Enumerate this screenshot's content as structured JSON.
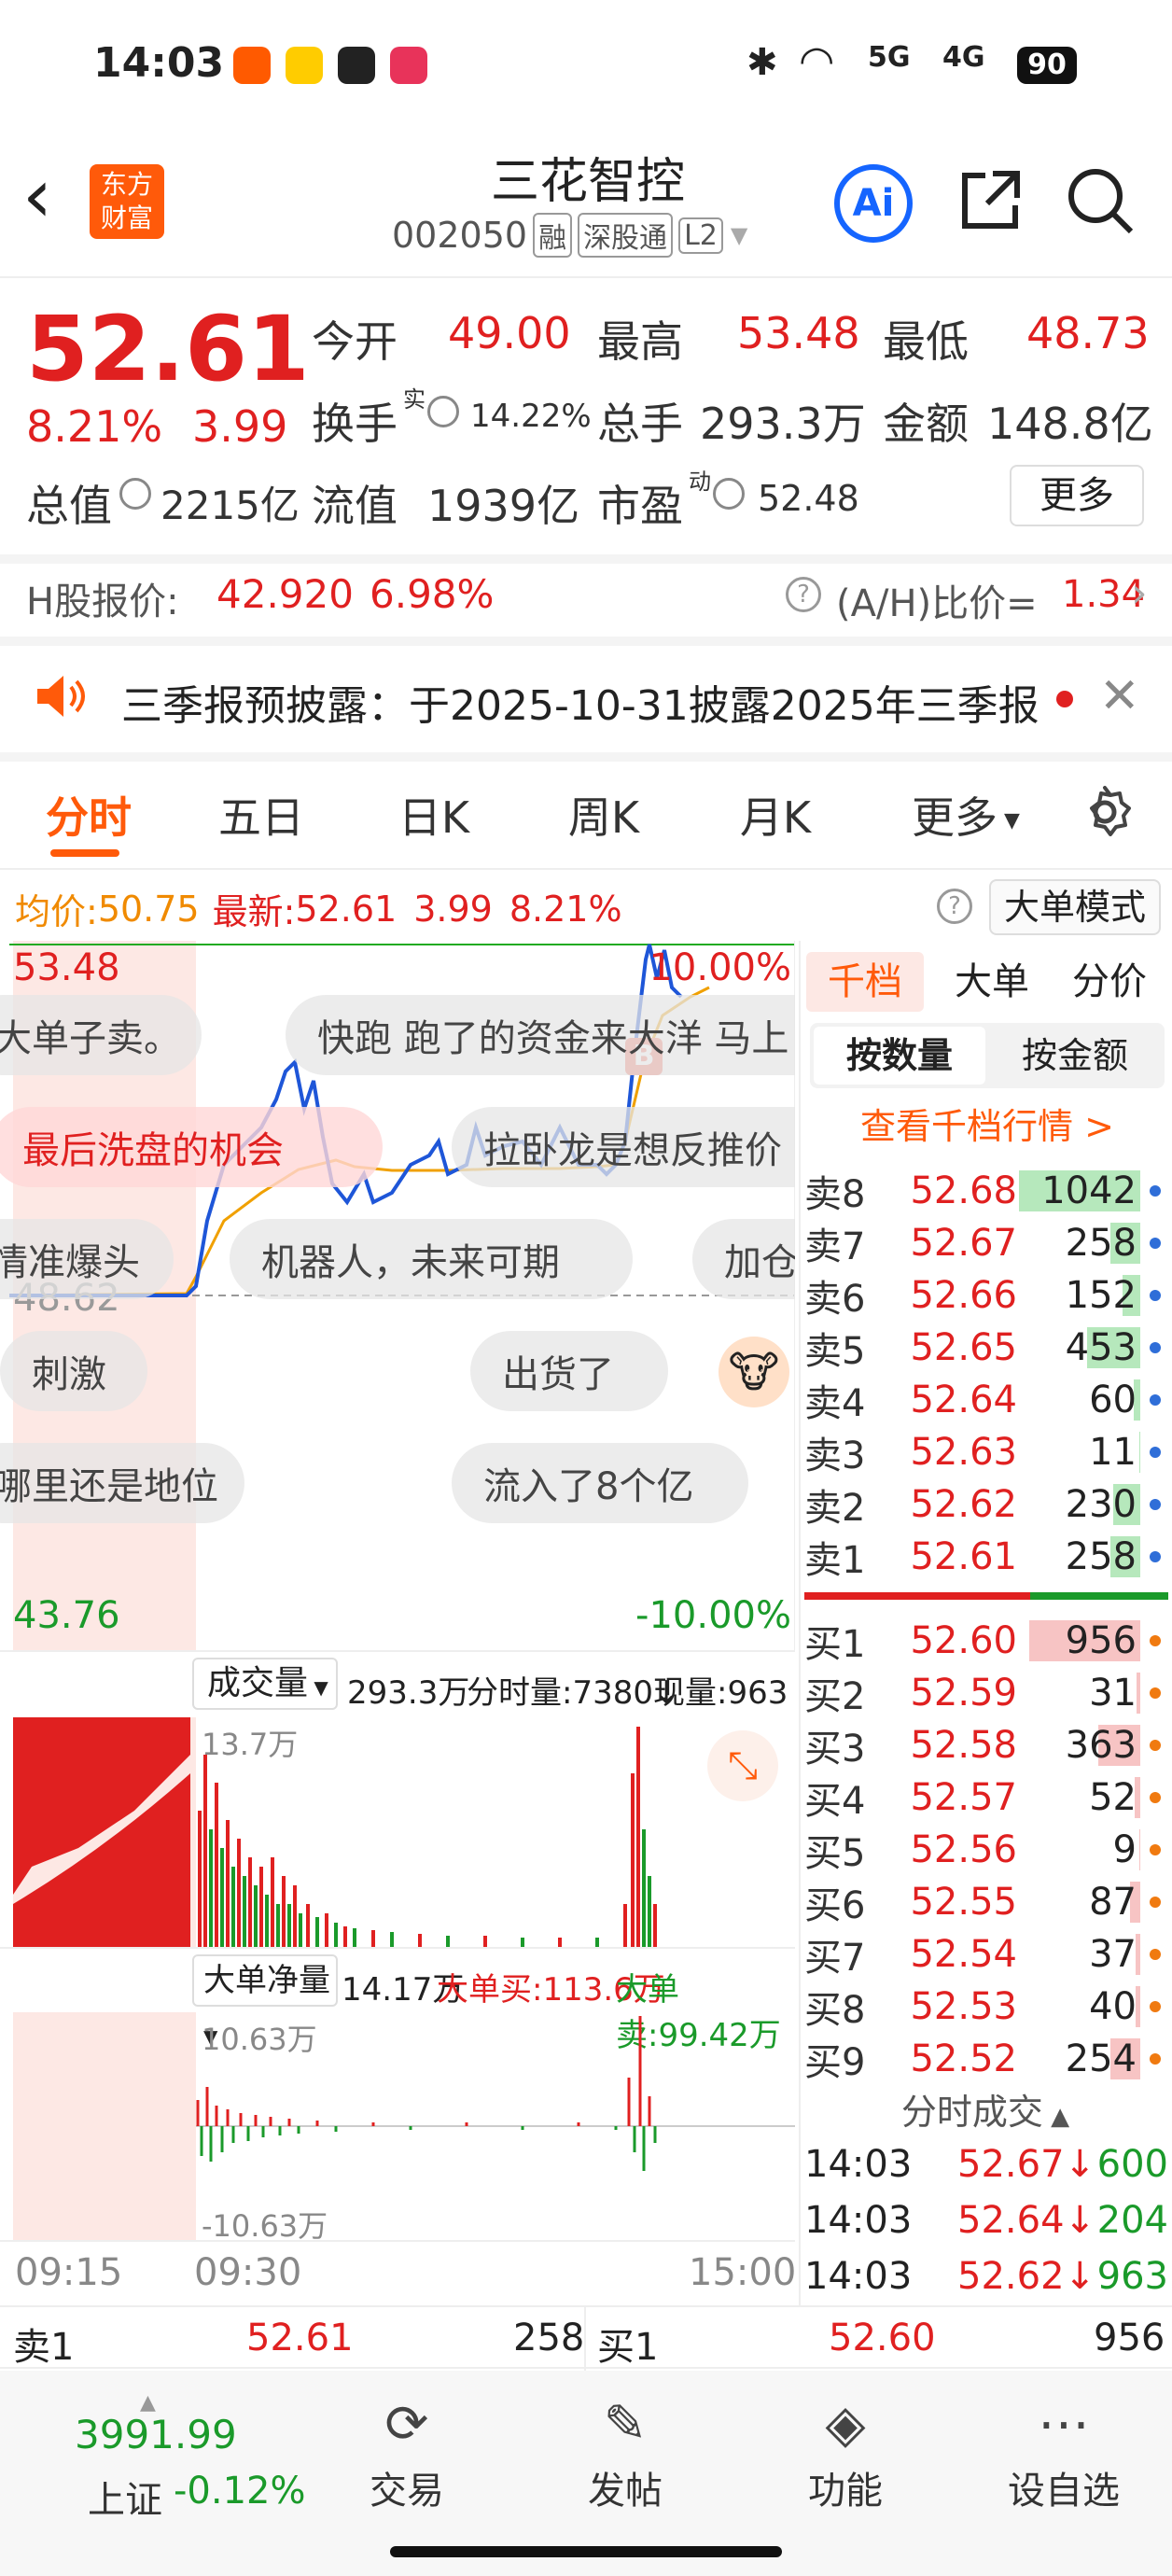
{
  "status_bar": {
    "time": "14:03",
    "battery": "90",
    "net1": "5G",
    "net2": "4G"
  },
  "header": {
    "back": "‹",
    "logo_line1": "东方",
    "logo_line2": "财富",
    "title": "三花智控",
    "code": "002050",
    "tag1": "融",
    "tag2": "深股通",
    "tag3": "L2",
    "ai": "Ai"
  },
  "quote": {
    "price": "52.61",
    "pct": "8.21%",
    "chg": "3.99",
    "open_label": "今开",
    "open": "49.00",
    "high_label": "最高",
    "high": "53.48",
    "low_label": "最低",
    "low": "48.73",
    "turnover_label": "换手",
    "turnover_sup": "实",
    "turnover": "14.22%",
    "vol_label": "总手",
    "vol": "293.3万",
    "amt_label": "金额",
    "amt": "148.8亿",
    "mcap_label": "总值",
    "mcap": "2215亿",
    "float_label": "流值",
    "float": "1939亿",
    "pe_label": "市盈",
    "pe_sup": "动",
    "pe": "52.48",
    "more": "更多"
  },
  "hshare": {
    "label": "H股报价:",
    "price": "42.920",
    "pct": "6.98%",
    "ratio_label": "(A/H)比价=",
    "ratio": "1.34"
  },
  "notice": {
    "text": "三季报预披露：于2025-10-31披露2025年三季报"
  },
  "tabs": [
    "分时",
    "五日",
    "日K",
    "周K",
    "月K",
    "更多"
  ],
  "info": {
    "avg_label": "均价:",
    "avg": "50.75",
    "latest_label": "最新:",
    "latest": "52.61",
    "chg": "3.99",
    "pct": "8.21%",
    "mode": "大单模式"
  },
  "chart": {
    "top_price": "53.48",
    "top_pct": "10.00%",
    "mid_price": "48.62",
    "bot_price": "43.76",
    "bot_pct": "-10.00%",
    "time_start": "09:15",
    "time_mid": "09:30",
    "time_end": "15:00",
    "b_marker": "B"
  },
  "bubbles": [
    "大单子卖。",
    "快跑 跑了的资金来大洋 马上",
    "最后洗盘的机会",
    "拉卧龙是想反推价",
    "情准爆头",
    "机器人，未来可期",
    "加仓",
    "刺激",
    "出货了",
    "哪里还是地位",
    "流入了8个亿"
  ],
  "volume": {
    "label": "成交量",
    "total": "293.3万",
    "tick_label": "分时量:7380↓",
    "now_label": "现量:963",
    "max": "13.7万"
  },
  "bigorder": {
    "label": "大单净量",
    "net": "14.17万",
    "buy": "大单买:113.6万",
    "sell": "大单卖:99.42万",
    "max": "10.63万",
    "min": "-10.63万"
  },
  "ob_tabs": {
    "t1": "千档",
    "t2": "大单",
    "t3": "分价",
    "q1": "按数量",
    "q2": "按金额",
    "link": "查看千档行情 >"
  },
  "asks": [
    {
      "l": "卖8",
      "p": "52.68",
      "q": "1042"
    },
    {
      "l": "卖7",
      "p": "52.67",
      "q": "258"
    },
    {
      "l": "卖6",
      "p": "52.66",
      "q": "152"
    },
    {
      "l": "卖5",
      "p": "52.65",
      "q": "453"
    },
    {
      "l": "卖4",
      "p": "52.64",
      "q": "60"
    },
    {
      "l": "卖3",
      "p": "52.63",
      "q": "11"
    },
    {
      "l": "卖2",
      "p": "52.62",
      "q": "230"
    },
    {
      "l": "卖1",
      "p": "52.61",
      "q": "258"
    }
  ],
  "bids": [
    {
      "l": "买1",
      "p": "52.60",
      "q": "956"
    },
    {
      "l": "买2",
      "p": "52.59",
      "q": "31"
    },
    {
      "l": "买3",
      "p": "52.58",
      "q": "363"
    },
    {
      "l": "买4",
      "p": "52.57",
      "q": "52"
    },
    {
      "l": "买5",
      "p": "52.56",
      "q": "9"
    },
    {
      "l": "买6",
      "p": "52.55",
      "q": "87"
    },
    {
      "l": "买7",
      "p": "52.54",
      "q": "37"
    },
    {
      "l": "买8",
      "p": "52.53",
      "q": "40"
    },
    {
      "l": "买9",
      "p": "52.52",
      "q": "254"
    }
  ],
  "ticks": {
    "label": "分时成交",
    "rows": [
      {
        "t": "14:03",
        "p": "52.67↓",
        "v": "600"
      },
      {
        "t": "14:03",
        "p": "52.64↓",
        "v": "204"
      },
      {
        "t": "14:03",
        "p": "52.62↓",
        "v": "963"
      }
    ]
  },
  "bottom_quote": {
    "sell_label": "卖1",
    "sell_p": "52.61",
    "sell_q": "258",
    "buy_label": "买1",
    "buy_p": "52.60",
    "buy_q": "956"
  },
  "nav": {
    "index_val": "3991.99",
    "index_name": "上证",
    "index_pct": "-0.12%",
    "n1": "交易",
    "n2": "发帖",
    "n3": "功能",
    "n4": "设自选"
  }
}
